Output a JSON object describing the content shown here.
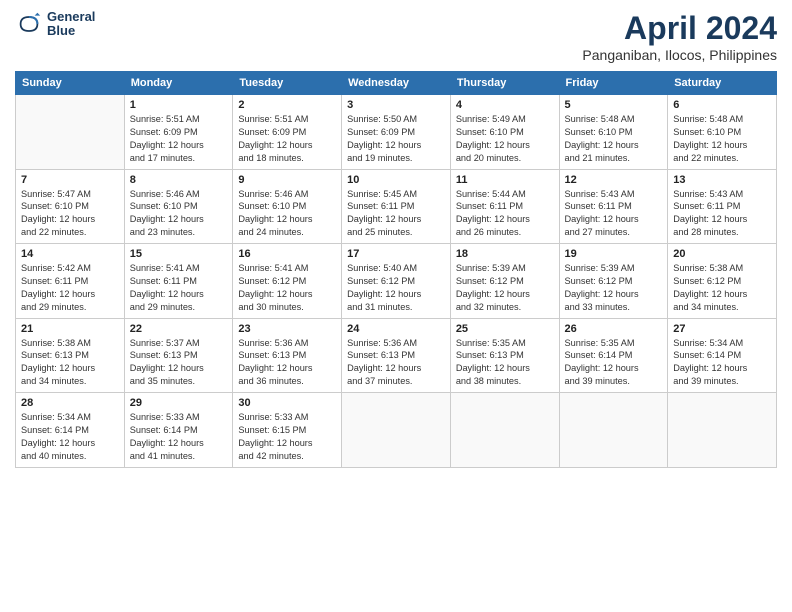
{
  "logo": {
    "line1": "General",
    "line2": "Blue"
  },
  "title": "April 2024",
  "subtitle": "Panganiban, Ilocos, Philippines",
  "weekdays": [
    "Sunday",
    "Monday",
    "Tuesday",
    "Wednesday",
    "Thursday",
    "Friday",
    "Saturday"
  ],
  "weeks": [
    [
      {
        "day": "",
        "info": ""
      },
      {
        "day": "1",
        "info": "Sunrise: 5:51 AM\nSunset: 6:09 PM\nDaylight: 12 hours\nand 17 minutes."
      },
      {
        "day": "2",
        "info": "Sunrise: 5:51 AM\nSunset: 6:09 PM\nDaylight: 12 hours\nand 18 minutes."
      },
      {
        "day": "3",
        "info": "Sunrise: 5:50 AM\nSunset: 6:09 PM\nDaylight: 12 hours\nand 19 minutes."
      },
      {
        "day": "4",
        "info": "Sunrise: 5:49 AM\nSunset: 6:10 PM\nDaylight: 12 hours\nand 20 minutes."
      },
      {
        "day": "5",
        "info": "Sunrise: 5:48 AM\nSunset: 6:10 PM\nDaylight: 12 hours\nand 21 minutes."
      },
      {
        "day": "6",
        "info": "Sunrise: 5:48 AM\nSunset: 6:10 PM\nDaylight: 12 hours\nand 22 minutes."
      }
    ],
    [
      {
        "day": "7",
        "info": "Sunrise: 5:47 AM\nSunset: 6:10 PM\nDaylight: 12 hours\nand 22 minutes."
      },
      {
        "day": "8",
        "info": "Sunrise: 5:46 AM\nSunset: 6:10 PM\nDaylight: 12 hours\nand 23 minutes."
      },
      {
        "day": "9",
        "info": "Sunrise: 5:46 AM\nSunset: 6:10 PM\nDaylight: 12 hours\nand 24 minutes."
      },
      {
        "day": "10",
        "info": "Sunrise: 5:45 AM\nSunset: 6:11 PM\nDaylight: 12 hours\nand 25 minutes."
      },
      {
        "day": "11",
        "info": "Sunrise: 5:44 AM\nSunset: 6:11 PM\nDaylight: 12 hours\nand 26 minutes."
      },
      {
        "day": "12",
        "info": "Sunrise: 5:43 AM\nSunset: 6:11 PM\nDaylight: 12 hours\nand 27 minutes."
      },
      {
        "day": "13",
        "info": "Sunrise: 5:43 AM\nSunset: 6:11 PM\nDaylight: 12 hours\nand 28 minutes."
      }
    ],
    [
      {
        "day": "14",
        "info": "Sunrise: 5:42 AM\nSunset: 6:11 PM\nDaylight: 12 hours\nand 29 minutes."
      },
      {
        "day": "15",
        "info": "Sunrise: 5:41 AM\nSunset: 6:11 PM\nDaylight: 12 hours\nand 29 minutes."
      },
      {
        "day": "16",
        "info": "Sunrise: 5:41 AM\nSunset: 6:12 PM\nDaylight: 12 hours\nand 30 minutes."
      },
      {
        "day": "17",
        "info": "Sunrise: 5:40 AM\nSunset: 6:12 PM\nDaylight: 12 hours\nand 31 minutes."
      },
      {
        "day": "18",
        "info": "Sunrise: 5:39 AM\nSunset: 6:12 PM\nDaylight: 12 hours\nand 32 minutes."
      },
      {
        "day": "19",
        "info": "Sunrise: 5:39 AM\nSunset: 6:12 PM\nDaylight: 12 hours\nand 33 minutes."
      },
      {
        "day": "20",
        "info": "Sunrise: 5:38 AM\nSunset: 6:12 PM\nDaylight: 12 hours\nand 34 minutes."
      }
    ],
    [
      {
        "day": "21",
        "info": "Sunrise: 5:38 AM\nSunset: 6:13 PM\nDaylight: 12 hours\nand 34 minutes."
      },
      {
        "day": "22",
        "info": "Sunrise: 5:37 AM\nSunset: 6:13 PM\nDaylight: 12 hours\nand 35 minutes."
      },
      {
        "day": "23",
        "info": "Sunrise: 5:36 AM\nSunset: 6:13 PM\nDaylight: 12 hours\nand 36 minutes."
      },
      {
        "day": "24",
        "info": "Sunrise: 5:36 AM\nSunset: 6:13 PM\nDaylight: 12 hours\nand 37 minutes."
      },
      {
        "day": "25",
        "info": "Sunrise: 5:35 AM\nSunset: 6:13 PM\nDaylight: 12 hours\nand 38 minutes."
      },
      {
        "day": "26",
        "info": "Sunrise: 5:35 AM\nSunset: 6:14 PM\nDaylight: 12 hours\nand 39 minutes."
      },
      {
        "day": "27",
        "info": "Sunrise: 5:34 AM\nSunset: 6:14 PM\nDaylight: 12 hours\nand 39 minutes."
      }
    ],
    [
      {
        "day": "28",
        "info": "Sunrise: 5:34 AM\nSunset: 6:14 PM\nDaylight: 12 hours\nand 40 minutes."
      },
      {
        "day": "29",
        "info": "Sunrise: 5:33 AM\nSunset: 6:14 PM\nDaylight: 12 hours\nand 41 minutes."
      },
      {
        "day": "30",
        "info": "Sunrise: 5:33 AM\nSunset: 6:15 PM\nDaylight: 12 hours\nand 42 minutes."
      },
      {
        "day": "",
        "info": ""
      },
      {
        "day": "",
        "info": ""
      },
      {
        "day": "",
        "info": ""
      },
      {
        "day": "",
        "info": ""
      }
    ]
  ]
}
